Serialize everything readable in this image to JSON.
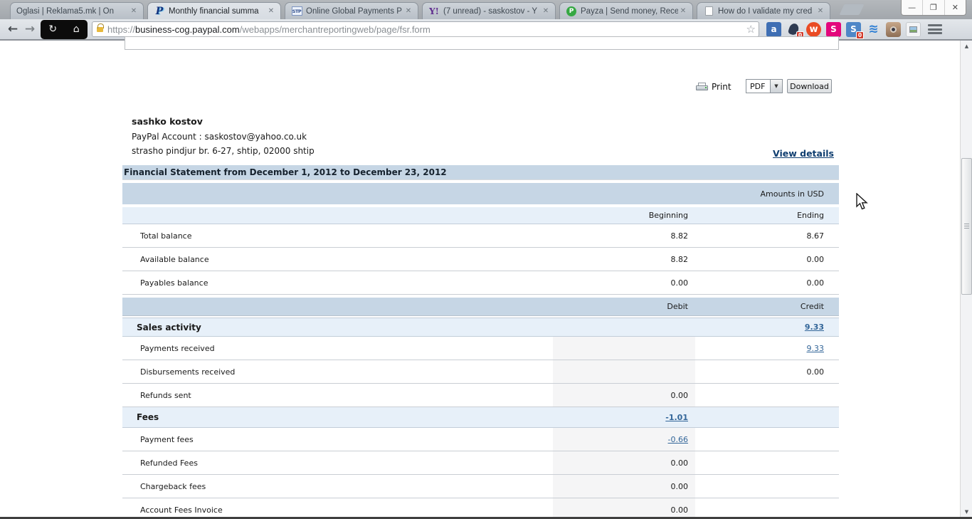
{
  "browser": {
    "tabs": [
      {
        "label": "Oglasi | Reklama5.mk | On",
        "close": "✕",
        "favicon": "none"
      },
      {
        "label": "Monthly financial summa",
        "close": "✕",
        "favicon": "paypal",
        "favicon_text": "P",
        "active": true
      },
      {
        "label": "Online Global Payments P",
        "close": "✕",
        "favicon": "stp",
        "favicon_text": "STP"
      },
      {
        "label": "(7 unread) - saskostov - Y",
        "close": "✕",
        "favicon": "yahoo",
        "favicon_text": "Y!"
      },
      {
        "label": "Payza | Send money, Rece",
        "close": "✕",
        "favicon": "payza",
        "favicon_text": "P"
      },
      {
        "label": "How do I validate my cred",
        "close": "✕",
        "favicon": "page"
      }
    ],
    "window_controls": {
      "minimize": "—",
      "restore": "❐",
      "close": "✕"
    },
    "toolbar": {
      "back_icon": "←",
      "forward_icon": "→",
      "reload_icon": "↻",
      "home_icon": "⌂",
      "url": {
        "scheme": "https://",
        "domain": "business-cog.paypal.com",
        "path": "/webapps/merchantreportingweb/page/fsr.form"
      },
      "bookmark_star": "☆",
      "extensions": [
        {
          "name": "extension-blue-a",
          "glyph": "a"
        },
        {
          "name": "extension-drop",
          "glyph": "",
          "badge": "0"
        },
        {
          "name": "extension-stumbleupon",
          "glyph": "w"
        },
        {
          "name": "extension-pink-s",
          "glyph": "S"
        },
        {
          "name": "extension-blue-s",
          "glyph": "S",
          "badge": "0"
        },
        {
          "name": "extension-waves",
          "glyph": "≋"
        },
        {
          "name": "extension-instagram",
          "glyph": ""
        },
        {
          "name": "extension-image-tool",
          "glyph": ""
        }
      ],
      "menu_icon": "≡"
    }
  },
  "page": {
    "print": {
      "print_label": "Print",
      "format_value": "PDF",
      "dropdown_arrow": "▼",
      "download_label": "Download"
    },
    "account": {
      "name": "sashko kostov",
      "paypal_account_line": "PayPal Account : saskostov@yahoo.co.uk",
      "address_line": "strasho pindjur br. 6-27, shtip, 02000 shtip"
    },
    "view_details_label": "View details",
    "statement": {
      "title": "Financial Statement from December 1, 2012 to December 23, 2012",
      "amounts_note": "Amounts in USD",
      "balance_headers": {
        "col1": "Beginning",
        "col2": "Ending"
      },
      "balance_rows": [
        {
          "label": "Total balance",
          "beginning": "8.82",
          "ending": "8.67"
        },
        {
          "label": "Available balance",
          "beginning": "8.82",
          "ending": "0.00"
        },
        {
          "label": "Payables balance",
          "beginning": "0.00",
          "ending": "0.00"
        }
      ],
      "activity_headers": {
        "col1": "Debit",
        "col2": "Credit"
      },
      "sales_section": {
        "label": "Sales activity",
        "credit_total": "9.33",
        "rows": [
          {
            "label": "Payments received",
            "credit": "9.33"
          },
          {
            "label": "Disbursements received",
            "credit": "0.00"
          },
          {
            "label": "Refunds sent",
            "debit": "0.00"
          }
        ]
      },
      "fees_section": {
        "label": "Fees",
        "debit_total": "-1.01",
        "rows": [
          {
            "label": "Payment fees",
            "debit": "-0.66"
          },
          {
            "label": "Refunded Fees",
            "debit": "0.00"
          },
          {
            "label": "Chargeback fees",
            "debit": "0.00"
          },
          {
            "label": "Account Fees Invoice",
            "debit": "0.00"
          }
        ]
      }
    }
  },
  "scrollbar": {
    "up_arrow": "▲",
    "down_arrow": "▼"
  },
  "colors": {
    "header_band": "#c6d6e5",
    "highlight_row": "#e7f0f9",
    "debit_column_shade": "#f5f5f6",
    "table_link": "#336699",
    "view_details_link": "#0f3e70",
    "badge_red": "#d23b2c",
    "payza_green": "#35a843",
    "yahoo_purple": "#5f2b8e",
    "paypal_navy": "#11327f"
  }
}
